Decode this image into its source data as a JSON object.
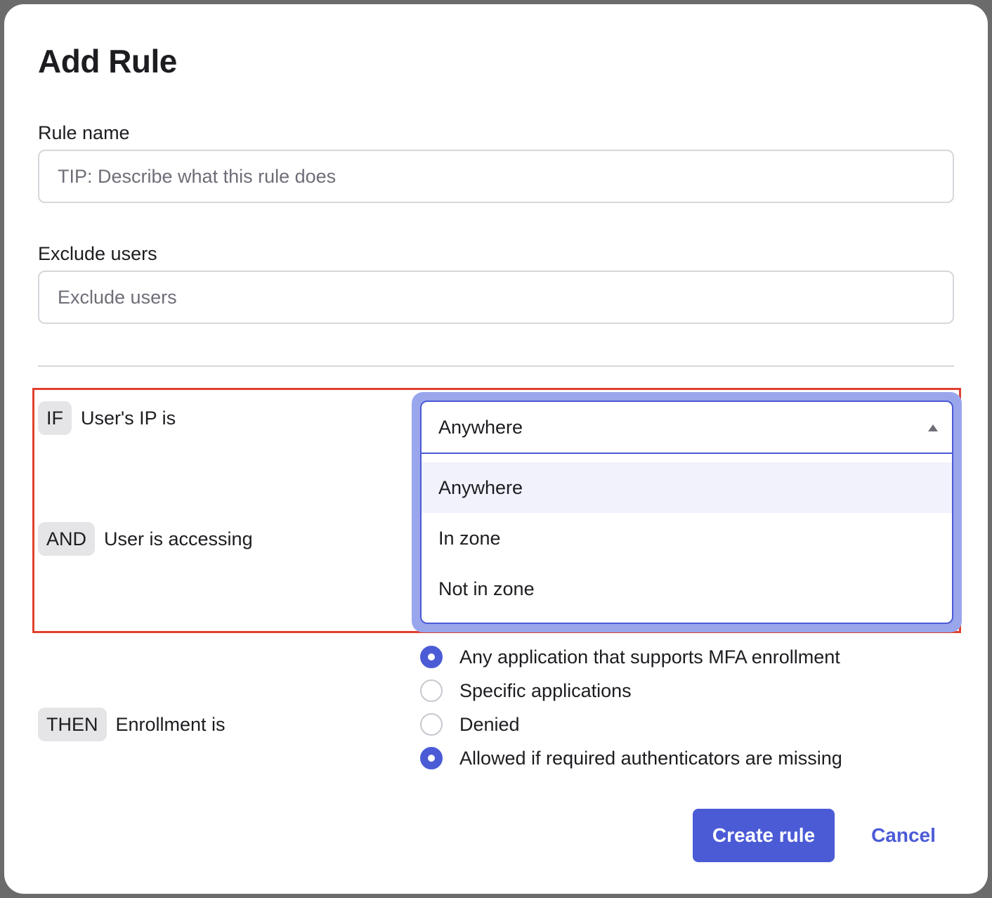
{
  "modal": {
    "title": "Add Rule"
  },
  "rule_name": {
    "label": "Rule name",
    "placeholder": "TIP: Describe what this rule does",
    "value": ""
  },
  "exclude_users": {
    "label": "Exclude users",
    "placeholder": "Exclude users"
  },
  "conditions": {
    "if": {
      "keyword": "IF",
      "text": "User's IP is"
    },
    "and": {
      "keyword": "AND",
      "text": "User is accessing"
    },
    "then": {
      "keyword": "THEN",
      "text": "Enrollment is"
    }
  },
  "ip_select": {
    "selected": "Anywhere",
    "options": [
      "Anywhere",
      "In zone",
      "Not in zone"
    ],
    "expanded": true,
    "caret_icon": "triangle-up-icon"
  },
  "radios": [
    {
      "label": "Any application that supports MFA enrollment",
      "checked": true
    },
    {
      "label": "Specific applications",
      "checked": false
    },
    {
      "label": "Denied",
      "checked": false
    },
    {
      "label": "Allowed if required authenticators are missing",
      "checked": true
    }
  ],
  "actions": {
    "create": "Create rule",
    "cancel": "Cancel"
  },
  "colors": {
    "accent": "#4b5bd6",
    "highlight": "#e0402f",
    "focus_ring": "#9aa6ec",
    "option_hover": "#f1f2fc"
  }
}
